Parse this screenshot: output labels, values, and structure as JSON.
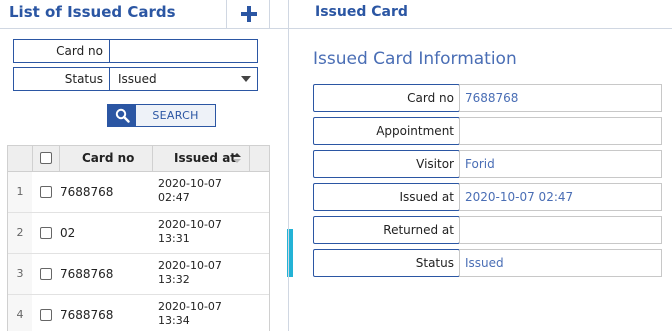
{
  "left_panel": {
    "title": "List of Issued Cards",
    "add_icon": "plus-icon",
    "filters": {
      "card_no": {
        "label": "Card no",
        "value": ""
      },
      "status": {
        "label": "Status",
        "value": "Issued"
      }
    },
    "search_button": {
      "label": "SEARCH",
      "icon": "search-icon"
    },
    "table": {
      "columns": {
        "card_no": "Card no",
        "issued_at": "Issued at"
      },
      "sort": {
        "column": "issued_at",
        "direction": "ascending"
      },
      "rows": [
        {
          "num": "1",
          "card_no": "7688768",
          "issued_date": "2020-10-07",
          "issued_time": "02:47"
        },
        {
          "num": "2",
          "card_no": "02",
          "issued_date": "2020-10-07",
          "issued_time": "13:31"
        },
        {
          "num": "3",
          "card_no": "7688768",
          "issued_date": "2020-10-07",
          "issued_time": "13:32"
        },
        {
          "num": "4",
          "card_no": "7688768",
          "issued_date": "2020-10-07",
          "issued_time": "13:34"
        }
      ]
    }
  },
  "right_panel": {
    "title": "Issued Card",
    "section_title": "Issued Card Information",
    "fields": [
      {
        "label": "Card no",
        "value": "7688768"
      },
      {
        "label": "Appointment",
        "value": ""
      },
      {
        "label": "Visitor",
        "value": "Forid"
      },
      {
        "label": "Issued at",
        "value": "2020-10-07 02:47"
      },
      {
        "label": "Returned at",
        "value": ""
      },
      {
        "label": "Status",
        "value": "Issued"
      }
    ]
  },
  "colors": {
    "primary": "#2b56a3",
    "value_text": "#4a6eb5",
    "scroll_accent": "#23b3d6"
  }
}
